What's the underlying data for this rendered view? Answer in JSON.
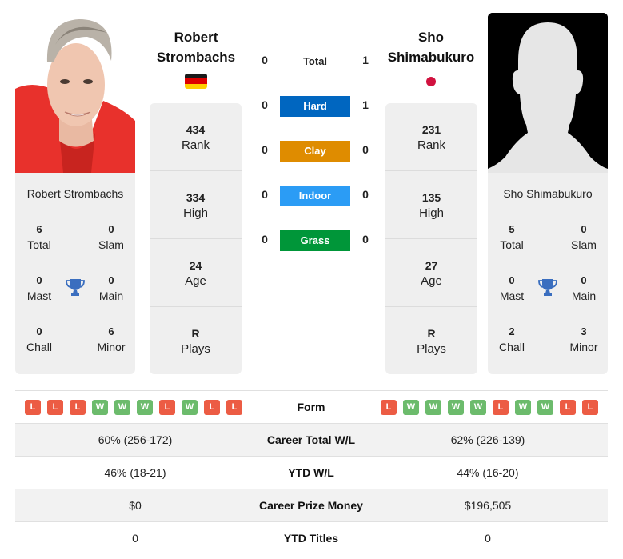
{
  "player_left": {
    "name": "Robert Strombachs",
    "name_line1": "Robert",
    "name_line2": "Strombachs",
    "country": "Germany",
    "flag_icon": "flag-germany-icon",
    "photo": "player-photo",
    "titles": {
      "total": "6",
      "total_label": "Total",
      "slam": "0",
      "slam_label": "Slam",
      "mast": "0",
      "mast_label": "Mast",
      "main": "0",
      "main_label": "Main",
      "chall": "0",
      "chall_label": "Chall",
      "minor": "6",
      "minor_label": "Minor"
    },
    "rank": "434",
    "rank_label": "Rank",
    "high": "334",
    "high_label": "High",
    "age": "24",
    "age_label": "Age",
    "plays": "R",
    "plays_label": "Plays",
    "form": [
      "L",
      "L",
      "L",
      "W",
      "W",
      "W",
      "L",
      "W",
      "L",
      "L"
    ],
    "career_wl": "60% (256-172)",
    "ytd_wl": "46% (18-21)",
    "prize_money": "$0",
    "ytd_titles": "0"
  },
  "player_right": {
    "name": "Sho Shimabukuro",
    "name_line1": "Sho",
    "name_line2": "Shimabukuro",
    "country": "Japan",
    "flag_icon": "flag-japan-icon",
    "photo": "placeholder-silhouette",
    "titles": {
      "total": "5",
      "total_label": "Total",
      "slam": "0",
      "slam_label": "Slam",
      "mast": "0",
      "mast_label": "Mast",
      "main": "0",
      "main_label": "Main",
      "chall": "2",
      "chall_label": "Chall",
      "minor": "3",
      "minor_label": "Minor"
    },
    "rank": "231",
    "rank_label": "Rank",
    "high": "135",
    "high_label": "High",
    "age": "27",
    "age_label": "Age",
    "plays": "R",
    "plays_label": "Plays",
    "form": [
      "L",
      "W",
      "W",
      "W",
      "W",
      "L",
      "W",
      "W",
      "L",
      "L"
    ],
    "career_wl": "62% (226-139)",
    "ytd_wl": "44% (16-20)",
    "prize_money": "$196,505",
    "ytd_titles": "0"
  },
  "h2h": {
    "total": {
      "label": "Total",
      "left": "0",
      "right": "1"
    },
    "surfaces": [
      {
        "label": "Hard",
        "left": "0",
        "right": "1",
        "color": "#0066c0"
      },
      {
        "label": "Clay",
        "left": "0",
        "right": "0",
        "color": "#df8c00"
      },
      {
        "label": "Indoor",
        "left": "0",
        "right": "0",
        "color": "#2b9cf5"
      },
      {
        "label": "Grass",
        "left": "0",
        "right": "0",
        "color": "#009639"
      }
    ]
  },
  "table": {
    "form_label": "Form",
    "career_wl_label": "Career Total W/L",
    "ytd_wl_label": "YTD W/L",
    "prize_label": "Career Prize Money",
    "ytd_titles_label": "YTD Titles"
  },
  "colors": {
    "loss": "#ec5c44",
    "win": "#6cbb6c",
    "trophy": "#3a6ebf"
  }
}
